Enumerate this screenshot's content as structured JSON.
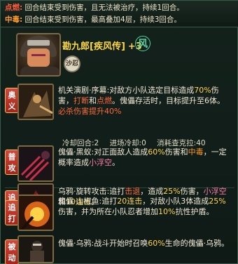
{
  "status": {
    "burn_label": "点燃:",
    "burn_text": "回合结束受到伤害，且无法被治疗，持续1回合。",
    "poison_label": "中毒:",
    "poison_text": "回合结束受到伤害，最高叠加4层，持续3回合。"
  },
  "character": {
    "name": "勘九郎[疾风传]",
    "level": "+3",
    "element": "风",
    "badge": "沙忍"
  },
  "skills": [
    {
      "tag": "奥义",
      "parts": [
        "机关演剧·序幕:对敌方小队选定目标造成",
        "70%",
        "伤害，",
        "打断",
        "和",
        "点燃",
        "。傀儡存活时，目标提升至6体。",
        "必杀伤害提升40%"
      ]
    },
    {
      "tag": "普攻",
      "parts": [
        "傀儡·黑蚁:对正面敌人造成",
        "60%",
        "伤害和",
        "中毒",
        "，一定概率造成",
        "小浮空",
        "。"
      ]
    },
    {
      "tag": "追打",
      "parts": [
        "乌鸦·旋转攻击:追打",
        "击退",
        "，造成",
        "25%",
        "伤害，",
        "小浮空",
        "和",
        "10连击",
        "。"
      ]
    },
    {
      "tag": "追打",
      "parts": [
        "傀儡·山椒鱼:追打",
        "20连击",
        "，对敌小队3体造成",
        "25%",
        "伤害，并为所在小队忍者增加",
        "10%",
        "抗性护盾。"
      ]
    },
    {
      "tag": "被动",
      "parts": [
        "傀儡·乌鸦:战斗开始时召唤",
        "60%",
        "生命的傀儡·乌鸦。"
      ]
    }
  ],
  "meta": {
    "cooldown": "冷却回合:2",
    "enter_cd": "进场冷却:0",
    "chakra": "消耗查克拉:40"
  },
  "colors": {
    "highlight_yellow": "#ffd449",
    "highlight_red": "#ff6a3a",
    "highlight_orange": "#ff9a2a",
    "highlight_pink": "#ff7ea8",
    "name_gold": "#fbd748",
    "element_green": "#56d3a4"
  },
  "icons": {
    "element": "wind-element-icon",
    "portrait": "kankuro-portrait"
  }
}
